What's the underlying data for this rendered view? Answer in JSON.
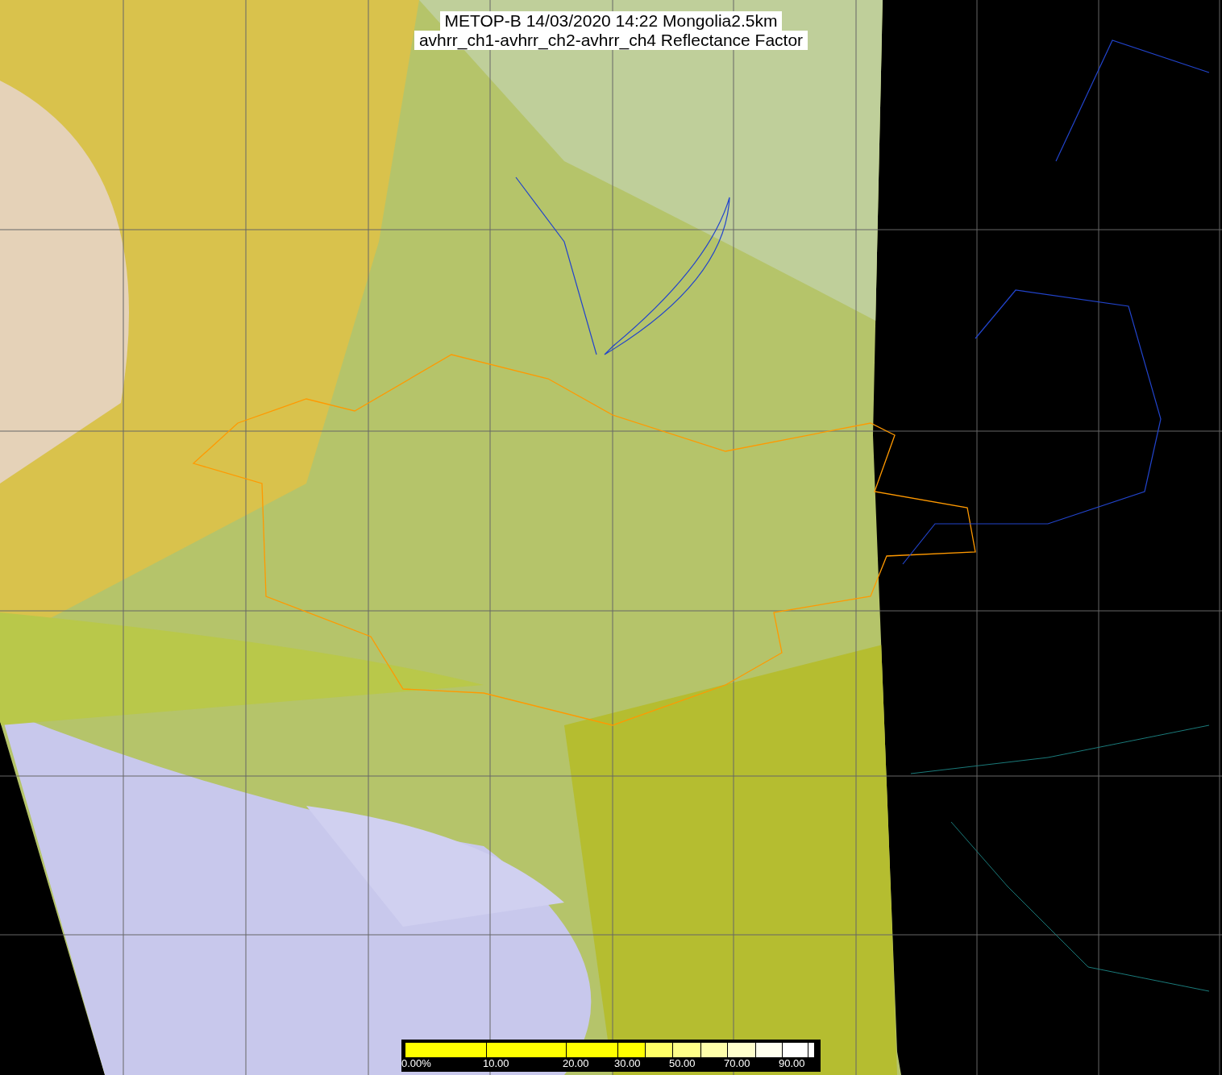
{
  "title": {
    "lines": [
      "METOP-B 14/03/2020 14:22 Mongolia2.5km",
      "avhrr_ch1-avhrr_ch2-avhrr_ch4 Reflectance Factor"
    ]
  },
  "legend": {
    "segments": [
      {
        "color": "#ffff00",
        "label": "0.00%"
      },
      {
        "color": "#ffff00",
        "label": "10.00"
      },
      {
        "color": "#ffff00",
        "label": "20.00"
      },
      {
        "color": "#ffff00",
        "label": "30.00"
      },
      {
        "color": "#ffff66"
      },
      {
        "color": "#ffff88",
        "label": "50.00"
      },
      {
        "color": "#ffffaa"
      },
      {
        "color": "#ffffcc",
        "label": "70.00"
      },
      {
        "color": "#ffffee"
      },
      {
        "color": "#ffffff",
        "label": "90.00"
      },
      {
        "color": "#ffffff"
      }
    ]
  }
}
